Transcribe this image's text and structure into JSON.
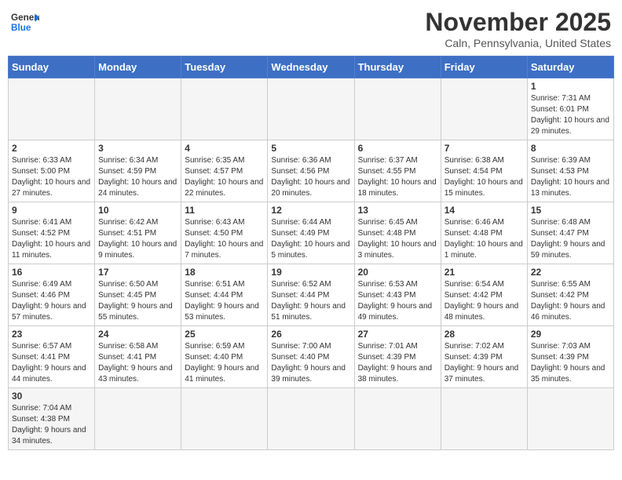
{
  "logo": {
    "text_general": "General",
    "text_blue": "Blue"
  },
  "header": {
    "month": "November 2025",
    "location": "Caln, Pennsylvania, United States"
  },
  "weekdays": [
    "Sunday",
    "Monday",
    "Tuesday",
    "Wednesday",
    "Thursday",
    "Friday",
    "Saturday"
  ],
  "weeks": [
    [
      {
        "day": "",
        "info": ""
      },
      {
        "day": "",
        "info": ""
      },
      {
        "day": "",
        "info": ""
      },
      {
        "day": "",
        "info": ""
      },
      {
        "day": "",
        "info": ""
      },
      {
        "day": "",
        "info": ""
      },
      {
        "day": "1",
        "info": "Sunrise: 7:31 AM\nSunset: 6:01 PM\nDaylight: 10 hours and 29 minutes."
      }
    ],
    [
      {
        "day": "2",
        "info": "Sunrise: 6:33 AM\nSunset: 5:00 PM\nDaylight: 10 hours and 27 minutes."
      },
      {
        "day": "3",
        "info": "Sunrise: 6:34 AM\nSunset: 4:59 PM\nDaylight: 10 hours and 24 minutes."
      },
      {
        "day": "4",
        "info": "Sunrise: 6:35 AM\nSunset: 4:57 PM\nDaylight: 10 hours and 22 minutes."
      },
      {
        "day": "5",
        "info": "Sunrise: 6:36 AM\nSunset: 4:56 PM\nDaylight: 10 hours and 20 minutes."
      },
      {
        "day": "6",
        "info": "Sunrise: 6:37 AM\nSunset: 4:55 PM\nDaylight: 10 hours and 18 minutes."
      },
      {
        "day": "7",
        "info": "Sunrise: 6:38 AM\nSunset: 4:54 PM\nDaylight: 10 hours and 15 minutes."
      },
      {
        "day": "8",
        "info": "Sunrise: 6:39 AM\nSunset: 4:53 PM\nDaylight: 10 hours and 13 minutes."
      }
    ],
    [
      {
        "day": "9",
        "info": "Sunrise: 6:41 AM\nSunset: 4:52 PM\nDaylight: 10 hours and 11 minutes."
      },
      {
        "day": "10",
        "info": "Sunrise: 6:42 AM\nSunset: 4:51 PM\nDaylight: 10 hours and 9 minutes."
      },
      {
        "day": "11",
        "info": "Sunrise: 6:43 AM\nSunset: 4:50 PM\nDaylight: 10 hours and 7 minutes."
      },
      {
        "day": "12",
        "info": "Sunrise: 6:44 AM\nSunset: 4:49 PM\nDaylight: 10 hours and 5 minutes."
      },
      {
        "day": "13",
        "info": "Sunrise: 6:45 AM\nSunset: 4:48 PM\nDaylight: 10 hours and 3 minutes."
      },
      {
        "day": "14",
        "info": "Sunrise: 6:46 AM\nSunset: 4:48 PM\nDaylight: 10 hours and 1 minute."
      },
      {
        "day": "15",
        "info": "Sunrise: 6:48 AM\nSunset: 4:47 PM\nDaylight: 9 hours and 59 minutes."
      }
    ],
    [
      {
        "day": "16",
        "info": "Sunrise: 6:49 AM\nSunset: 4:46 PM\nDaylight: 9 hours and 57 minutes."
      },
      {
        "day": "17",
        "info": "Sunrise: 6:50 AM\nSunset: 4:45 PM\nDaylight: 9 hours and 55 minutes."
      },
      {
        "day": "18",
        "info": "Sunrise: 6:51 AM\nSunset: 4:44 PM\nDaylight: 9 hours and 53 minutes."
      },
      {
        "day": "19",
        "info": "Sunrise: 6:52 AM\nSunset: 4:44 PM\nDaylight: 9 hours and 51 minutes."
      },
      {
        "day": "20",
        "info": "Sunrise: 6:53 AM\nSunset: 4:43 PM\nDaylight: 9 hours and 49 minutes."
      },
      {
        "day": "21",
        "info": "Sunrise: 6:54 AM\nSunset: 4:42 PM\nDaylight: 9 hours and 48 minutes."
      },
      {
        "day": "22",
        "info": "Sunrise: 6:55 AM\nSunset: 4:42 PM\nDaylight: 9 hours and 46 minutes."
      }
    ],
    [
      {
        "day": "23",
        "info": "Sunrise: 6:57 AM\nSunset: 4:41 PM\nDaylight: 9 hours and 44 minutes."
      },
      {
        "day": "24",
        "info": "Sunrise: 6:58 AM\nSunset: 4:41 PM\nDaylight: 9 hours and 43 minutes."
      },
      {
        "day": "25",
        "info": "Sunrise: 6:59 AM\nSunset: 4:40 PM\nDaylight: 9 hours and 41 minutes."
      },
      {
        "day": "26",
        "info": "Sunrise: 7:00 AM\nSunset: 4:40 PM\nDaylight: 9 hours and 39 minutes."
      },
      {
        "day": "27",
        "info": "Sunrise: 7:01 AM\nSunset: 4:39 PM\nDaylight: 9 hours and 38 minutes."
      },
      {
        "day": "28",
        "info": "Sunrise: 7:02 AM\nSunset: 4:39 PM\nDaylight: 9 hours and 37 minutes."
      },
      {
        "day": "29",
        "info": "Sunrise: 7:03 AM\nSunset: 4:39 PM\nDaylight: 9 hours and 35 minutes."
      }
    ],
    [
      {
        "day": "30",
        "info": "Sunrise: 7:04 AM\nSunset: 4:38 PM\nDaylight: 9 hours and 34 minutes."
      },
      {
        "day": "",
        "info": ""
      },
      {
        "day": "",
        "info": ""
      },
      {
        "day": "",
        "info": ""
      },
      {
        "day": "",
        "info": ""
      },
      {
        "day": "",
        "info": ""
      },
      {
        "day": "",
        "info": ""
      }
    ]
  ]
}
